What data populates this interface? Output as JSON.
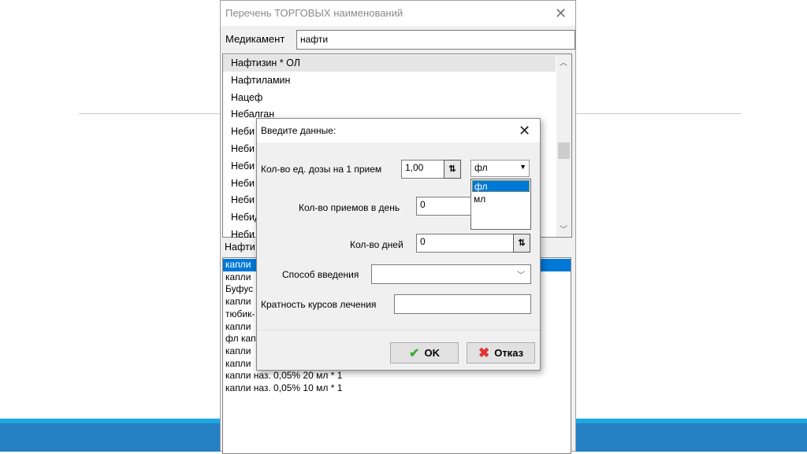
{
  "window": {
    "title": "Перечень ТОРГОВЫХ наименований",
    "medicament_label": "Медикамент",
    "medicament_value": "нафти",
    "names": [
      "Нафтизин  * ОЛ",
      "Нафтиламин",
      "Нацеф",
      "Небалган",
      "Неби",
      "Неби",
      "Неби",
      "Неби",
      "Неби",
      "Небид",
      "Неби"
    ],
    "section_label": "Нафти",
    "forms": [
      "капли",
      "капли",
      "Буфус",
      "капли",
      "тюбик-",
      "капли",
      "фл кап",
      "капли",
      "капли",
      "капли наз. 0,05% 20 мл * 1",
      "капли наз. 0,05% 10 мл * 1"
    ]
  },
  "dialog": {
    "title": "Введите данные:",
    "dose_label": "Кол-во ед. дозы на 1 прием",
    "dose_value": "1,00",
    "unit_value": "фл",
    "unit_options": [
      "фл",
      "мл"
    ],
    "per_day_label": "Кол-во приемов в день",
    "per_day_value": "0",
    "days_label": "Кол-во дней",
    "days_value": "0",
    "route_label": "Способ введения",
    "route_value": "",
    "courses_label": "Кратность курсов лечения",
    "courses_value": "",
    "ok_label": "OK",
    "cancel_label": "Отказ"
  },
  "colors": {
    "selection": "#0078d7",
    "band_light": "#1ea8e0",
    "band_dark": "#2580c3"
  }
}
